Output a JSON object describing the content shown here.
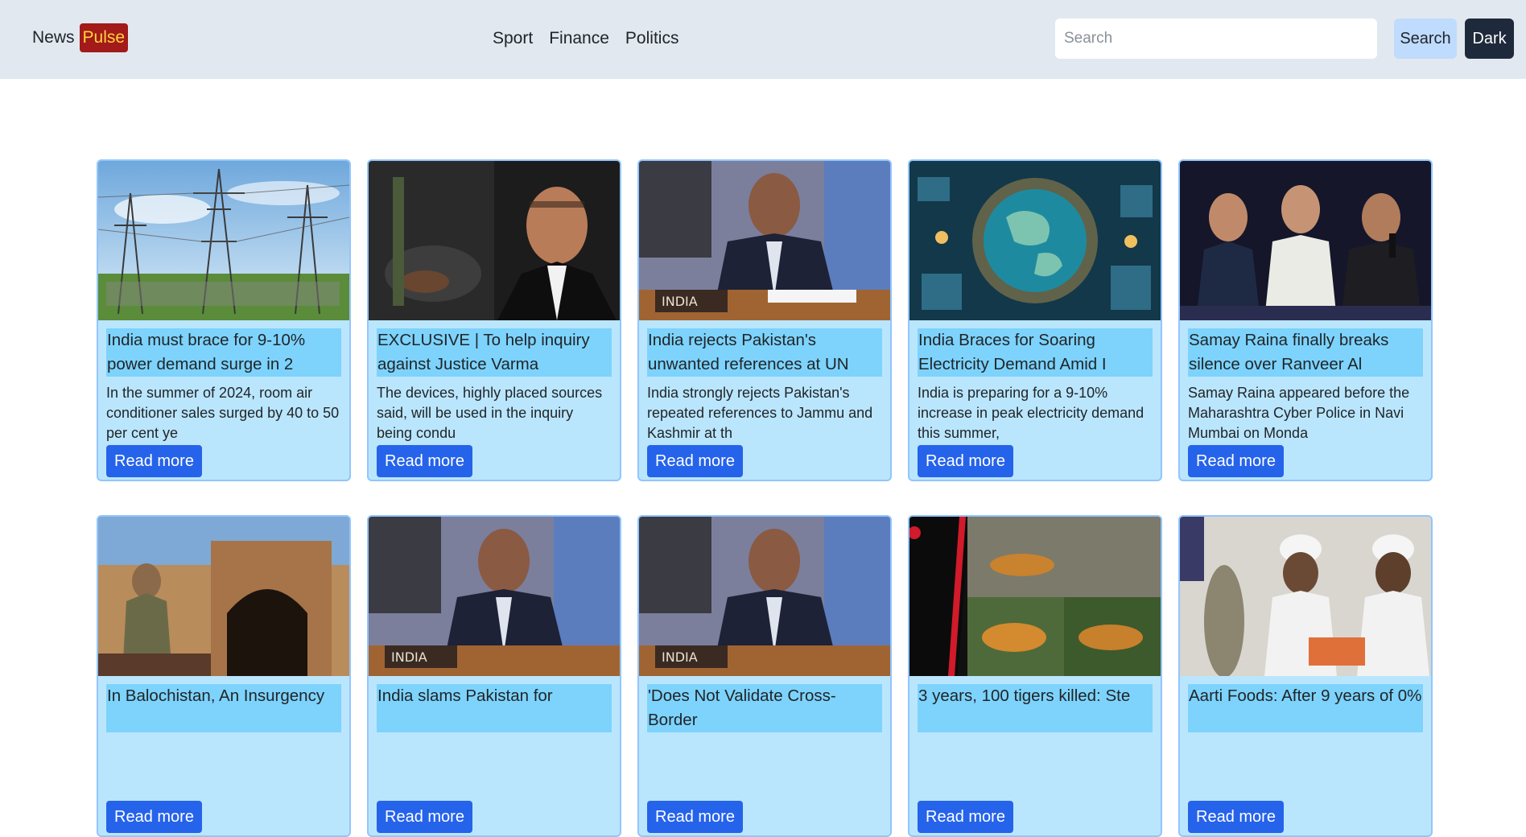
{
  "brand": {
    "name": "News",
    "accent": "Pulse"
  },
  "nav": [
    "Sport",
    "Finance",
    "Politics"
  ],
  "search": {
    "placeholder": "Search",
    "button_label": "Search"
  },
  "theme_button_label": "Dark",
  "colors": {
    "navbar": "#e2e8f0",
    "card": "#bae6fd",
    "title_highlight": "#7dd3fc",
    "button": "#2563eb",
    "brand_badge": "#a21a1a",
    "brand_text": "#ffd43b"
  },
  "articles": [
    {
      "title": "India must brace for 9-10% power demand surge in 2",
      "description": "In the summer of 2024, room air conditioner sales surged by 40 to 50 per cent ye",
      "button": "Read more",
      "image": "power-lines-photo"
    },
    {
      "title": "EXCLUSIVE | To help inquiry against Justice Varma",
      "description": "The devices, highly placed sources said, will be used in the inquiry being condu",
      "button": "Read more",
      "image": "burnt-cash-and-judge-photo"
    },
    {
      "title": "India rejects Pakistan's unwanted references at UN",
      "description": "India strongly rejects Pakistan's repeated references to Jammu and Kashmir at th",
      "button": "Read more",
      "image": "un-india-delegate-photo"
    },
    {
      "title": "India Braces for Soaring Electricity Demand Amid I",
      "description": "India is preparing for a 9-10% increase in peak electricity demand this summer,",
      "button": "Read more",
      "image": "globe-energy-illustration"
    },
    {
      "title": "Samay Raina finally breaks silence over Ranveer Al",
      "description": "Samay Raina appeared before the Maharashtra Cyber Police in Navi Mumbai on Monda",
      "button": "Read more",
      "image": "three-men-podcast-photo"
    },
    {
      "title": "In Balochistan, An Insurgency",
      "description": "",
      "button": "Read more",
      "image": "soldier-tunnel-photo"
    },
    {
      "title": "India slams Pakistan for",
      "description": "",
      "button": "Read more",
      "image": "un-india-delegate-photo"
    },
    {
      "title": "'Does Not Validate Cross-Border",
      "description": "",
      "button": "Read more",
      "image": "un-india-delegate-photo"
    },
    {
      "title": "3 years, 100 tigers killed: Ste",
      "description": "",
      "button": "Read more",
      "image": "tigers-collage-photo"
    },
    {
      "title": "Aarti Foods: After 9 years of 0%",
      "description": "",
      "button": "Read more",
      "image": "food-workers-photo"
    }
  ]
}
